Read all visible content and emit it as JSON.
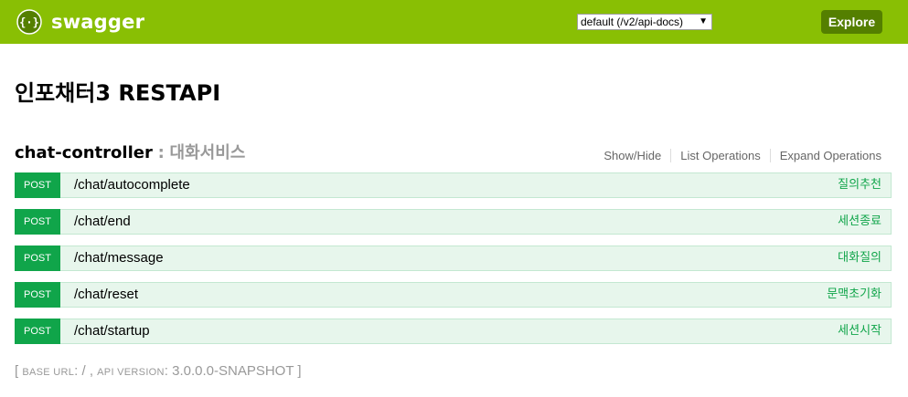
{
  "header": {
    "logo_text": "swagger",
    "logo_icon": "swagger-braces-icon",
    "spec_selector_value": "default (/v2/api-docs)",
    "explore_label": "Explore",
    "brand_color": "#89bf04"
  },
  "info": {
    "title": "인포채터3 RESTAPI"
  },
  "resource": {
    "name": "chat-controller",
    "separator": ":",
    "description": "대화서비스",
    "options": [
      "Show/Hide",
      "List Operations",
      "Expand Operations"
    ],
    "operations": [
      {
        "method": "POST",
        "path": "/chat/autocomplete",
        "summary": "질의추천"
      },
      {
        "method": "POST",
        "path": "/chat/end",
        "summary": "세션종료"
      },
      {
        "method": "POST",
        "path": "/chat/message",
        "summary": "대화질의"
      },
      {
        "method": "POST",
        "path": "/chat/reset",
        "summary": "문맥초기화"
      },
      {
        "method": "POST",
        "path": "/chat/startup",
        "summary": "세션시작"
      }
    ]
  },
  "footer": {
    "open_bracket": "[",
    "base_url_label": "BASE URL",
    "base_url_value": ": / ,",
    "api_version_label": "API VERSION",
    "api_version_value": ": 3.0.0.0-SNAPSHOT",
    "close_bracket": "]"
  }
}
